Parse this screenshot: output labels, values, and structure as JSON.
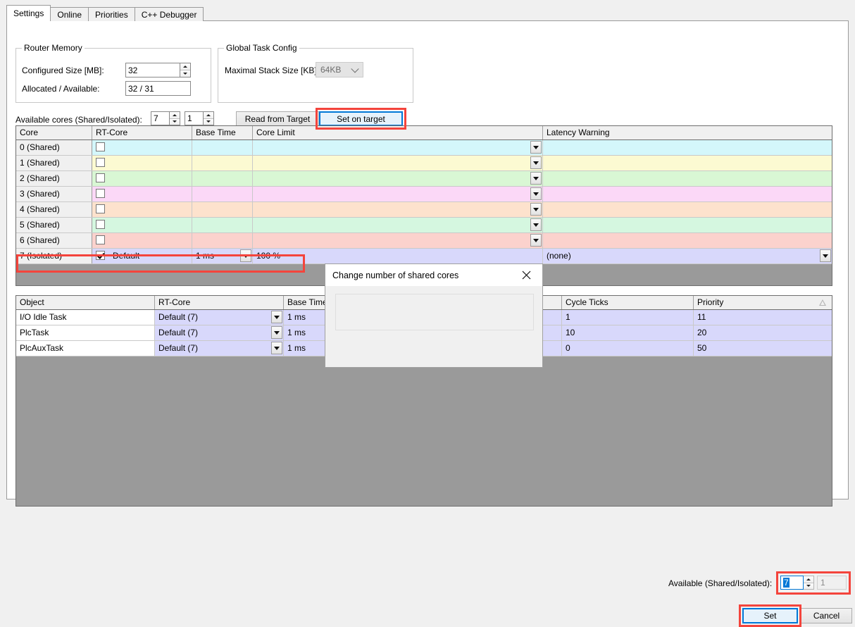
{
  "tabs": [
    {
      "label": "Settings",
      "active": true
    },
    {
      "label": "Online",
      "active": false
    },
    {
      "label": "Priorities",
      "active": false
    },
    {
      "label": "C++ Debugger",
      "active": false
    }
  ],
  "router_memory": {
    "title": "Router Memory",
    "configured_size_label": "Configured Size [MB]:",
    "configured_size_value": "32",
    "allocated_label": "Allocated / Available:",
    "allocated_value": "32 / 31"
  },
  "global_task_config": {
    "title": "Global Task Config",
    "max_stack_label": "Maximal Stack Size [KB]",
    "max_stack_value": "64KB"
  },
  "cores_row": {
    "label": "Available cores (Shared/Isolated):",
    "shared_value": "7",
    "isolated_value": "1",
    "read_from_target": "Read from Target",
    "set_on_target": "Set on target"
  },
  "core_table": {
    "headers": [
      "Core",
      "RT-Core",
      "Base Time",
      "Core Limit",
      "Latency Warning"
    ],
    "rows": [
      {
        "core": "0 (Shared)",
        "checked": false,
        "rt_core": "",
        "base_time": "",
        "core_limit": "",
        "latency": "",
        "color": "#d4f7fb"
      },
      {
        "core": "1 (Shared)",
        "checked": false,
        "rt_core": "",
        "base_time": "",
        "core_limit": "",
        "latency": "",
        "color": "#fcfad2"
      },
      {
        "core": "2 (Shared)",
        "checked": false,
        "rt_core": "",
        "base_time": "",
        "core_limit": "",
        "latency": "",
        "color": "#d9f7d4"
      },
      {
        "core": "3 (Shared)",
        "checked": false,
        "rt_core": "",
        "base_time": "",
        "core_limit": "",
        "latency": "",
        "color": "#fbd8f7"
      },
      {
        "core": "4 (Shared)",
        "checked": false,
        "rt_core": "",
        "base_time": "",
        "core_limit": "",
        "latency": "",
        "color": "#fde2cd"
      },
      {
        "core": "5 (Shared)",
        "checked": false,
        "rt_core": "",
        "base_time": "",
        "core_limit": "",
        "latency": "",
        "color": "#d5f7e0"
      },
      {
        "core": "6 (Shared)",
        "checked": false,
        "rt_core": "",
        "base_time": "",
        "core_limit": "",
        "latency": "",
        "color": "#fbd2cd"
      },
      {
        "core": "7 (Isolated)",
        "checked": true,
        "rt_core": "Default",
        "base_time": "1 ms",
        "core_limit": "100 %",
        "latency": "(none)",
        "color": "#d8d8fb"
      }
    ]
  },
  "task_table": {
    "headers": [
      "Object",
      "RT-Core",
      "Base Time",
      "Cycle Ticks",
      "Priority"
    ],
    "sort_column": "Priority",
    "sort_direction": "ascending",
    "rows": [
      {
        "object": "I/O Idle Task",
        "rt_core": "Default (7)",
        "base_time": "1 ms",
        "cycle_ticks": "1",
        "priority": "11"
      },
      {
        "object": "PlcTask",
        "rt_core": "Default (7)",
        "base_time": "1 ms",
        "cycle_ticks": "10",
        "priority": "20"
      },
      {
        "object": "PlcAuxTask",
        "rt_core": "Default (7)",
        "base_time": "1 ms",
        "cycle_ticks": "0",
        "priority": "50"
      }
    ]
  },
  "dialog": {
    "title": "Change number of shared cores",
    "close_icon": "close-icon",
    "field_label": "Available (Shared/Isolated):",
    "shared_value": "7",
    "isolated_value": "1",
    "set_label": "Set",
    "cancel_label": "Cancel"
  },
  "colors": {
    "highlight": "#f4443c",
    "focus_blue": "#0078d7",
    "grid_empty": "#9a9a9a"
  }
}
